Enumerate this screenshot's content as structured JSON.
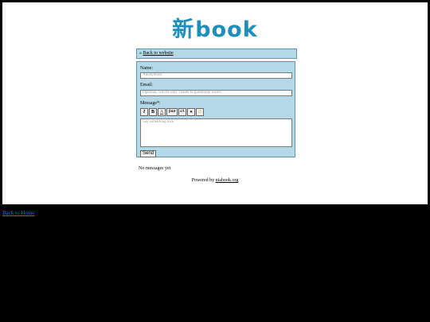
{
  "logo": {
    "cjk": "新",
    "text": "book"
  },
  "back_link": {
    "prefix": "«",
    "label": "Back to website"
  },
  "form": {
    "name_label": "Name:",
    "name_placeholder": "Anonymous",
    "email_label": "Email:",
    "email_placeholder": "Optional, will be only visible to guestbook owner",
    "message_label": "Message*:",
    "message_placeholder": "Say something nice",
    "toolbar": {
      "italic": "I",
      "bold": "B",
      "underline": "A",
      "font": "font",
      "size": "aA",
      "color": "●",
      "emoji": "☺"
    },
    "send_label": "Send"
  },
  "messages_status": "No messages yet",
  "footer": {
    "powered_prefix": "Powered by",
    "powered_link": "niabook.org"
  },
  "home_link": "Back to Home",
  "colors": {
    "accent": "#1d8fbd",
    "panel": "#b3d9e8",
    "border": "#5c98aa",
    "link": "#2a6fd1"
  }
}
